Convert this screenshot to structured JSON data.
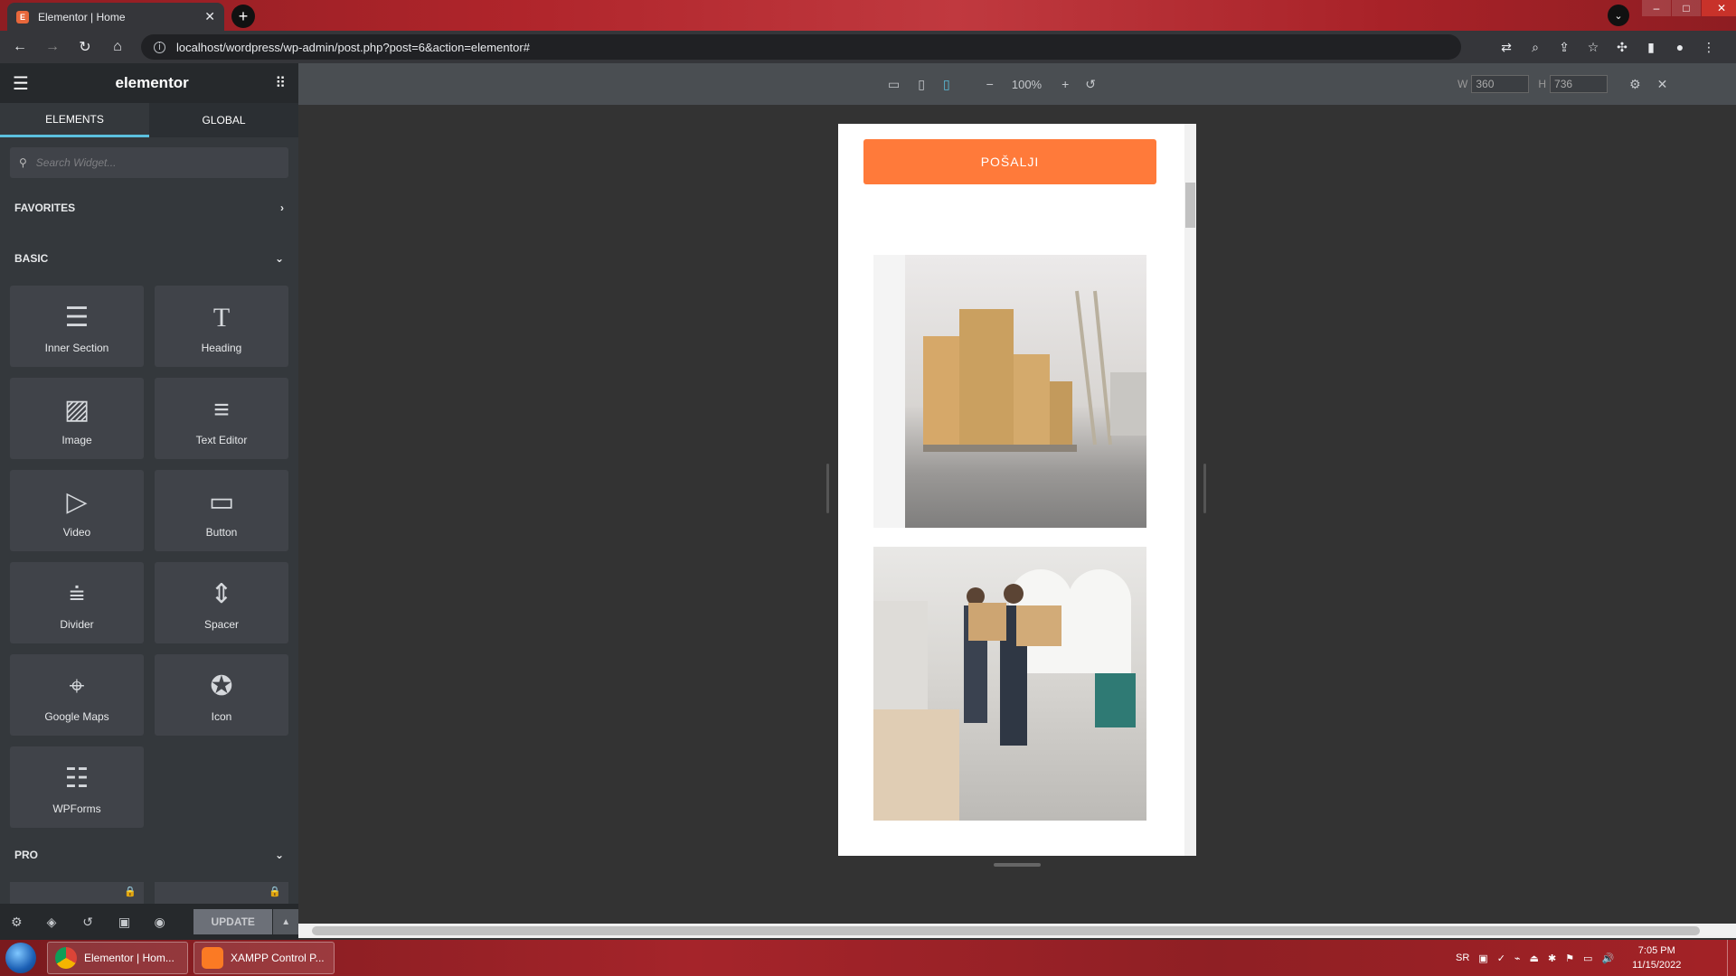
{
  "browser": {
    "tab_title": "Elementor | Home",
    "tab_favicon_letter": "E",
    "url": "localhost/wordpress/wp-admin/post.php?post=6&action=elementor#"
  },
  "panel": {
    "logo": "elementor",
    "tabs": [
      "ELEMENTS",
      "GLOBAL"
    ],
    "search_placeholder": "Search Widget...",
    "categories": {
      "favorites": "FAVORITES",
      "basic": "BASIC",
      "pro": "PRO"
    },
    "widgets": [
      {
        "label": "Inner Section",
        "icon": "inner-section-icon"
      },
      {
        "label": "Heading",
        "icon": "heading-icon"
      },
      {
        "label": "Image",
        "icon": "image-icon"
      },
      {
        "label": "Text Editor",
        "icon": "text-editor-icon"
      },
      {
        "label": "Video",
        "icon": "video-icon"
      },
      {
        "label": "Button",
        "icon": "button-icon"
      },
      {
        "label": "Divider",
        "icon": "divider-icon"
      },
      {
        "label": "Spacer",
        "icon": "spacer-icon"
      },
      {
        "label": "Google Maps",
        "icon": "google-maps-icon"
      },
      {
        "label": "Icon",
        "icon": "star-icon"
      },
      {
        "label": "WPForms",
        "icon": "wpforms-icon"
      }
    ],
    "update_label": "UPDATE"
  },
  "responsive_bar": {
    "zoom": "100%",
    "w_label": "W",
    "h_label": "H",
    "width_value": "360",
    "height_value": "736"
  },
  "preview": {
    "send_button": "POŠALJI"
  },
  "taskbar": {
    "items": [
      "Elementor | Hom...",
      "XAMPP Control P..."
    ],
    "lang": "SR",
    "time": "7:05 PM",
    "date": "11/15/2022"
  },
  "colors": {
    "accent": "#5bc0de",
    "send_button": "#ff7a3a",
    "panel": "#34383c"
  }
}
